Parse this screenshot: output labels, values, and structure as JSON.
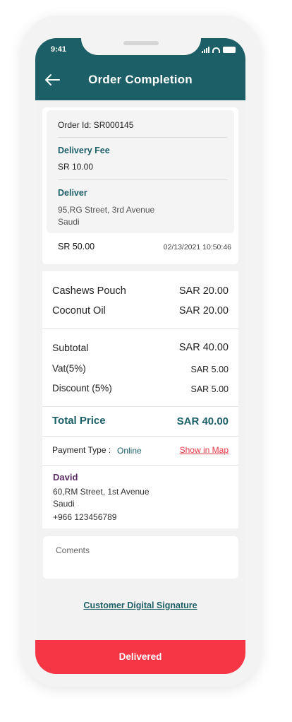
{
  "status_bar": {
    "time": "9:41"
  },
  "header": {
    "title": "Order Completion"
  },
  "order": {
    "id_text": "Order Id: SR000145",
    "delivery_fee_label": "Delivery Fee",
    "delivery_fee_value": "SR 10.00",
    "deliver_label": "Deliver",
    "deliver_address_line1": "95,RG Street, 3rd Avenue",
    "deliver_address_line2": "Saudi",
    "total": "SR 50.00",
    "date": "02/13/2021",
    "time": "10:50:46"
  },
  "items": [
    {
      "name": "Cashews Pouch",
      "price": "SAR 20.00"
    },
    {
      "name": "Coconut Oil",
      "price": "SAR 20.00"
    }
  ],
  "summary": {
    "subtotal_label": "Subtotal",
    "subtotal_value": "SAR 40.00",
    "vat_label": "Vat(5%)",
    "vat_value": "SAR 5.00",
    "discount_label": "Discount (5%)",
    "discount_value": "SAR 5.00",
    "total_label": "Total Price",
    "total_value": "SAR 40.00"
  },
  "payment": {
    "label": "Payment Type :",
    "value": "Online",
    "map_link": "Show in Map"
  },
  "customer": {
    "name": "David",
    "address_line1": "60,RM Street, 1st Avenue",
    "address_line2": "Saudi",
    "phone": "+966 123456789"
  },
  "comments": {
    "placeholder": "Coments"
  },
  "signature_link": "Customer Digital Signature",
  "action_button": "Delivered",
  "colors": {
    "primary_teal": "#1c5f66",
    "action_red": "#f63545",
    "link_red": "#e63946",
    "customer_name_purple": "#5a2d62"
  }
}
